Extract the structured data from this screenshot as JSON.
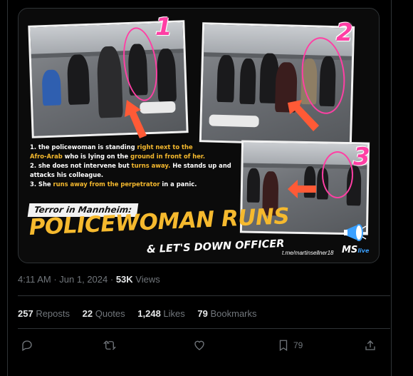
{
  "image": {
    "panel_numbers": [
      "1",
      "2",
      "3"
    ],
    "caption_lines": [
      {
        "parts": [
          {
            "t": "1. the policewoman is standing ",
            "h": false
          },
          {
            "t": "right next to the",
            "h": true
          }
        ]
      },
      {
        "parts": [
          {
            "t": "Afro-Arab",
            "h": true
          },
          {
            "t": " who is lying on the ",
            "h": false
          },
          {
            "t": "ground in front of her.",
            "h": true
          }
        ]
      },
      {
        "parts": [
          {
            "t": "2. she does not intervene but ",
            "h": false
          },
          {
            "t": "turns away.",
            "h": true
          },
          {
            "t": " He stands up and",
            "h": false
          }
        ]
      },
      {
        "parts": [
          {
            "t": "attacks his colleague.",
            "h": false
          }
        ]
      },
      {
        "parts": [
          {
            "t": "3. She ",
            "h": false
          },
          {
            "t": "runs away from the perpetrator",
            "h": true
          },
          {
            "t": " in a panic.",
            "h": false
          }
        ]
      }
    ],
    "terror_label": "Terror in Mannheim:",
    "headline": "POLICEWOMAN RUNS",
    "subhead": "& LET'S DOWN OFFICER",
    "handle": "t.me/martinsellner18",
    "ms_logo": "MS",
    "ms_logo_small": "live"
  },
  "meta": {
    "time": "4:11 AM",
    "dot": " · ",
    "date": "Jun 1, 2024",
    "views_count": "53K",
    "views_label": " Views"
  },
  "stats": [
    {
      "count": "257",
      "label": " Reposts"
    },
    {
      "count": "22",
      "label": " Quotes"
    },
    {
      "count": "1,248",
      "label": " Likes"
    },
    {
      "count": "79",
      "label": " Bookmarks"
    }
  ],
  "actions": {
    "reply_icon": "reply-icon",
    "repost_icon": "repost-icon",
    "like_icon": "heart-icon",
    "bookmark_icon": "bookmark-icon",
    "bookmark_count": "79",
    "share_icon": "share-icon"
  },
  "colors": {
    "highlight": "#f5b92e",
    "pink": "#ff3fa4",
    "arrow": "#ff5a36",
    "muted": "#71767b"
  }
}
